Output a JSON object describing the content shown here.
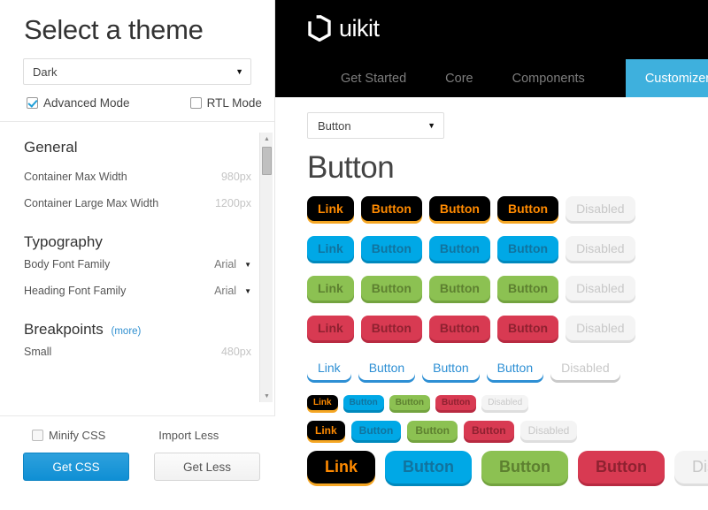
{
  "customizer": {
    "title": "Select a theme",
    "theme_select": {
      "value": "Dark",
      "caret": "▼"
    },
    "advanced_mode": {
      "label": "Advanced Mode",
      "checked": true
    },
    "rtl_mode": {
      "label": "RTL Mode",
      "checked": false
    },
    "sections": [
      {
        "title": "General",
        "more": "",
        "options": [
          {
            "label": "Container Max Width",
            "value": "980px",
            "type": "value"
          },
          {
            "label": "Container Large Max Width",
            "value": "1200px",
            "type": "value"
          }
        ]
      },
      {
        "title": "Typography",
        "more": "",
        "options": [
          {
            "label": "Body Font Family",
            "value": "Arial",
            "type": "select"
          },
          {
            "label": "Heading Font Family",
            "value": "Arial",
            "type": "select"
          }
        ]
      },
      {
        "title": "Breakpoints",
        "more": "(more)",
        "options": [
          {
            "label": "Small",
            "value": "480px",
            "type": "value"
          }
        ]
      }
    ],
    "footer": {
      "minify_css": {
        "label": "Minify CSS",
        "checked": false
      },
      "import_less_label": "Import Less",
      "get_css_label": "Get CSS",
      "get_less_label": "Get Less"
    },
    "scrollbar": {
      "up_arrow": "▲",
      "down_arrow": "▼"
    }
  },
  "navbar": {
    "brand": "uikit",
    "tabs": [
      {
        "label": "Get Started",
        "active": false
      },
      {
        "label": "Core",
        "active": false
      },
      {
        "label": "Components",
        "active": false
      },
      {
        "label": "Customizer",
        "active": true
      }
    ]
  },
  "preview": {
    "component_select": {
      "value": "Button",
      "caret": "▼"
    },
    "heading": "Button",
    "button_rows": [
      {
        "size": "size-normal",
        "buttons": [
          {
            "label": "Link",
            "variant": "v-dark"
          },
          {
            "label": "Button",
            "variant": "v-dark"
          },
          {
            "label": "Button",
            "variant": "v-dark"
          },
          {
            "label": "Button",
            "variant": "v-dark"
          },
          {
            "label": "Disabled",
            "variant": "v-muted"
          }
        ]
      },
      {
        "size": "size-normal",
        "buttons": [
          {
            "label": "Link",
            "variant": "v-blue"
          },
          {
            "label": "Button",
            "variant": "v-blue"
          },
          {
            "label": "Button",
            "variant": "v-blue"
          },
          {
            "label": "Button",
            "variant": "v-blue"
          },
          {
            "label": "Disabled",
            "variant": "v-muted"
          }
        ]
      },
      {
        "size": "size-normal",
        "buttons": [
          {
            "label": "Link",
            "variant": "v-green"
          },
          {
            "label": "Button",
            "variant": "v-green"
          },
          {
            "label": "Button",
            "variant": "v-green"
          },
          {
            "label": "Button",
            "variant": "v-green"
          },
          {
            "label": "Disabled",
            "variant": "v-muted"
          }
        ]
      },
      {
        "size": "size-normal",
        "buttons": [
          {
            "label": "Link",
            "variant": "v-red"
          },
          {
            "label": "Button",
            "variant": "v-red"
          },
          {
            "label": "Button",
            "variant": "v-red"
          },
          {
            "label": "Button",
            "variant": "v-red"
          },
          {
            "label": "Disabled",
            "variant": "v-muted"
          }
        ]
      },
      {
        "size": "size-normal",
        "buttons": [
          {
            "label": "Link",
            "variant": "v-link"
          },
          {
            "label": "Button",
            "variant": "v-link"
          },
          {
            "label": "Button",
            "variant": "v-link"
          },
          {
            "label": "Button",
            "variant": "v-link"
          },
          {
            "label": "Disabled",
            "variant": "v-link-muted"
          }
        ]
      },
      {
        "size": "size-mini",
        "buttons": [
          {
            "label": "Link",
            "variant": "v-dark"
          },
          {
            "label": "Button",
            "variant": "v-blue"
          },
          {
            "label": "Button",
            "variant": "v-green"
          },
          {
            "label": "Button",
            "variant": "v-red"
          },
          {
            "label": "Disabled",
            "variant": "v-muted"
          }
        ]
      },
      {
        "size": "size-small",
        "buttons": [
          {
            "label": "Link",
            "variant": "v-dark"
          },
          {
            "label": "Button",
            "variant": "v-blue"
          },
          {
            "label": "Button",
            "variant": "v-green"
          },
          {
            "label": "Button",
            "variant": "v-red"
          },
          {
            "label": "Disabled",
            "variant": "v-muted"
          }
        ]
      },
      {
        "size": "size-large",
        "buttons": [
          {
            "label": "Link",
            "variant": "v-dark"
          },
          {
            "label": "Button",
            "variant": "v-blue"
          },
          {
            "label": "Button",
            "variant": "v-green"
          },
          {
            "label": "Button",
            "variant": "v-red"
          },
          {
            "label": "Disabled",
            "variant": "v-muted"
          }
        ]
      }
    ]
  },
  "colors": {
    "accent_blue": "#00a8e6",
    "nav_active": "#3eb0dd",
    "orange": "#ff8a00",
    "green": "#8cc152",
    "red": "#d83a52",
    "black": "#000000",
    "muted": "#f4f4f4"
  }
}
